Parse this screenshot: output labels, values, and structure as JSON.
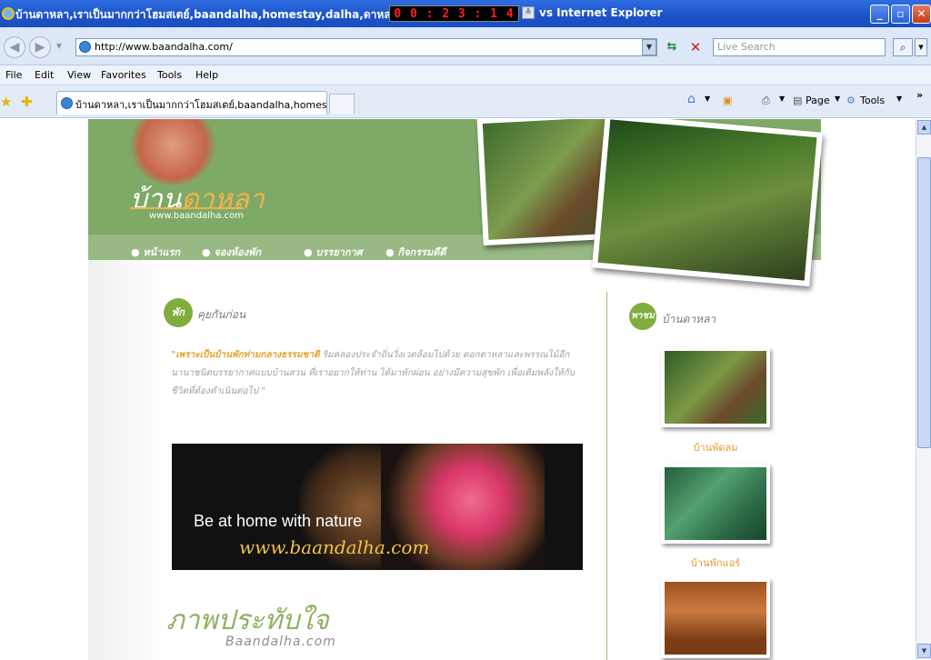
{
  "window": {
    "title_left": "บ้านดาหลา,เราเป็นมากกว่าโฮมสเตย์,baandalha,homestay,dalha,ดาหลา,",
    "counter_digits": [
      "0",
      "0",
      ":",
      "2",
      "3",
      ":",
      "1",
      "4"
    ],
    "title_right": "vs Internet Explorer",
    "minimize": "_",
    "maximize": "▫",
    "close": "✕"
  },
  "address_bar": {
    "url": "http://www.baandalha.com/",
    "search_placeholder": "Live Search"
  },
  "menu": [
    "File",
    "Edit",
    "View",
    "Favorites",
    "Tools",
    "Help"
  ],
  "tab": {
    "label": "บ้านดาหลา,เราเป็นมากกว่าโฮมสเตย์,baandalha,homest..."
  },
  "command_bar": {
    "page_label": "Page",
    "tools_label": "Tools",
    "more": "»"
  },
  "site": {
    "logo_main": "บ้าน",
    "logo_accent": "ดาหลา",
    "logo_url": "www.baandalha.com",
    "nav": [
      "● หน้าแรก",
      "● จองห้องพัก",
      "● บรรยากาศ",
      "● กิจกรรมดีดี"
    ],
    "section1_badge": "พัก",
    "section1_title": "คุยกันก่อน",
    "intro_highlight": "\"เพราะเป็นบ้านพักท่ามกลางธรรมชาติ",
    "intro_text": " ริมคลองประจำถิ่นวิ่งเวดล้อมไปด้วย ดอกดาหลาและพรรณไม้อีกนานาชนิดบรรยากาศแบบบ้านสวน ที่เราอยากให้ท่าน ได้มาพักผ่อน อย่างมีความสุขพัก เพื่อเติมพลังให้กับชีวิตที่ต้องดำเนินต่อไป \"",
    "banner_tagline": "Be at home with nature",
    "banner_url": "www.baandalha.com",
    "impress_title": "ภาพประทับใจ",
    "impress_sub": "Baandalha.com",
    "section2_badge": "พาชม",
    "section2_title": "บ้านดาหลา",
    "rooms": [
      "บ้านพัดลม",
      "บ้านพักแอร์"
    ]
  },
  "colors": {
    "header_green": "#7ea966",
    "accent_orange": "#e59b2e",
    "titlebar_blue": "#1c52c9"
  }
}
